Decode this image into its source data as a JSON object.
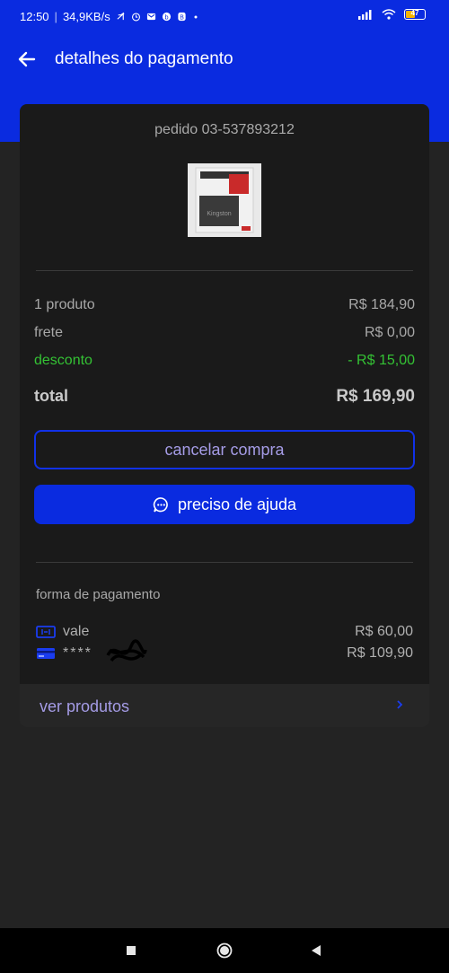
{
  "status_bar": {
    "time": "12:50",
    "speed": "34,9KB/s",
    "battery": "47",
    "icons": [
      "mute-icon",
      "alarm-icon",
      "mail-icon",
      "app-icon",
      "app-icon-2",
      "dot-icon"
    ],
    "right_icons": [
      "signal-icon",
      "wifi-icon",
      "battery-icon"
    ]
  },
  "header": {
    "title": "detalhes do pagamento",
    "back_icon": "arrow-left-icon",
    "color": "#0a2be0"
  },
  "order": {
    "id_label": "pedido 03-537893212",
    "product_image": "ssd-product-image",
    "product_image_text": "Kingston"
  },
  "summary": {
    "items_label": "1 produto",
    "items_value": "R$ 184,90",
    "shipping_label": "frete",
    "shipping_value": "R$ 0,00",
    "discount_label": "desconto",
    "discount_value": "- R$ 15,00",
    "total_label": "total",
    "total_value": "R$ 169,90",
    "discount_color": "#34c234"
  },
  "actions": {
    "cancel_label": "cancelar compra",
    "help_label": "preciso de ajuda",
    "help_icon": "chat-bubble-icon"
  },
  "payment": {
    "section_label": "forma de pagamento",
    "methods": [
      {
        "icon": "voucher-icon",
        "label": "vale",
        "value": "R$ 60,00"
      },
      {
        "icon": "credit-card-icon",
        "label": "****",
        "value": "R$ 109,90"
      }
    ]
  },
  "footer": {
    "products_label": "ver produtos",
    "chevron_icon": "chevron-right-icon"
  },
  "nav": {
    "icons": [
      "square-icon",
      "circle-icon",
      "triangle-back-icon"
    ]
  }
}
